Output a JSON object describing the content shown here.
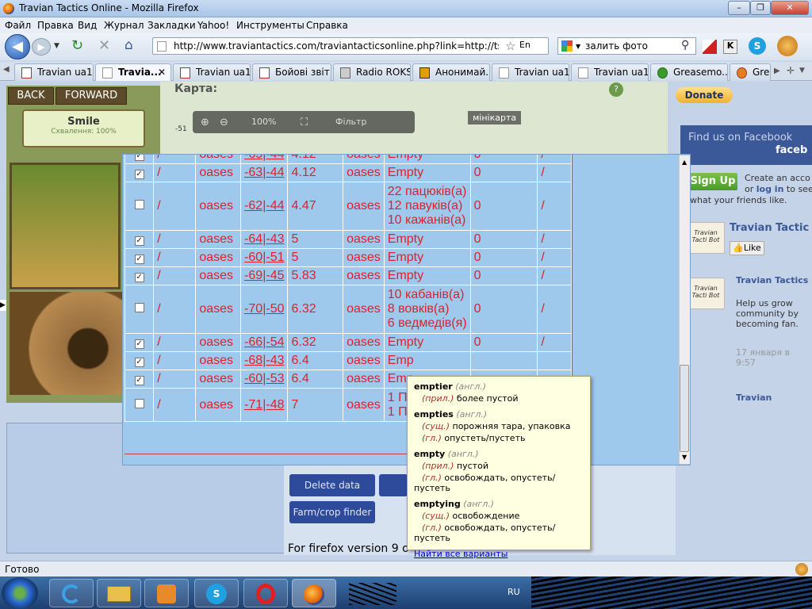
{
  "window": {
    "title": "Travian Tactics Online - Mozilla Firefox"
  },
  "menu": [
    "Файл",
    "Правка",
    "Вид",
    "Журнал",
    "Закладки",
    "Yahoo!",
    "Инструменты",
    "Справка"
  ],
  "nav": {
    "url": "http://www.traviantactics.com/traviantacticsonline.php?link=http://ts1.traviar",
    "search_value": "залить фото",
    "lang_badge": "En"
  },
  "tabs": [
    {
      "label": "Travian ua1"
    },
    {
      "label": "Travia..."
    },
    {
      "label": "Travian ua1"
    },
    {
      "label": "Бойові звіт..."
    },
    {
      "label": "Radio ROKS"
    },
    {
      "label": "Анонимай..."
    },
    {
      "label": "Travian ua1"
    },
    {
      "label": "Travian ua1"
    },
    {
      "label": "Greasemo..."
    },
    {
      "label": "Grea"
    }
  ],
  "page": {
    "back": "BACK",
    "forward": "FORWARD",
    "smile_title": "Smile",
    "smile_sub": "Схвалення: 100%",
    "map_title": "Карта:",
    "zoom": "100%",
    "filter": "Фільтр",
    "minimap": "мінікарта",
    "delete_data": "Delete data",
    "farm_finder": "Farm/crop finder",
    "firefox_note": "For firefox version 9 o",
    "side_num": "-51"
  },
  "sidebar": {
    "donate": "Donate",
    "facebook": "Find us on Facebook",
    "facebook_tail": "faceb",
    "signup": "Sign Up",
    "create": "Create an acco",
    "or": "or",
    "login": "log in",
    "to_see": "to see",
    "friends": "what your friends like.",
    "page_name": "Travian Tactic",
    "like": "Like",
    "thumb1": "Travian Tacti Bot",
    "post_title": "Travian Tactics",
    "post_text": "Help us grow community by becoming fan.",
    "post_date": "17 января в 9:57",
    "thumb2": "Travian Tacti Bot",
    "post2_title": "Travian"
  },
  "table": {
    "rows": [
      {
        "checked": true,
        "slash": "/",
        "type": "oases",
        "coord": "-65|-44",
        "dist": "4.12",
        "kind": "oases",
        "content": [
          "Empty"
        ],
        "n": "0",
        "end": "/"
      },
      {
        "checked": true,
        "slash": "/",
        "type": "oases",
        "coord": "-63|-44",
        "dist": "4.12",
        "kind": "oases",
        "content": [
          "Empty"
        ],
        "n": "0",
        "end": "/"
      },
      {
        "checked": false,
        "slash": "/",
        "type": "oases",
        "coord": "-62|-44",
        "dist": "4.47",
        "kind": "oases",
        "content": [
          "22 пацюків(а)",
          "12 павуків(а)",
          "10 кажанів(а)"
        ],
        "n": "0",
        "end": "/"
      },
      {
        "checked": true,
        "slash": "/",
        "type": "oases",
        "coord": "-64|-43",
        "dist": "5",
        "kind": "oases",
        "content": [
          "Empty"
        ],
        "n": "0",
        "end": "/"
      },
      {
        "checked": true,
        "slash": "/",
        "type": "oases",
        "coord": "-60|-51",
        "dist": "5",
        "kind": "oases",
        "content": [
          "Empty"
        ],
        "n": "0",
        "end": "/"
      },
      {
        "checked": true,
        "slash": "/",
        "type": "oases",
        "coord": "-69|-45",
        "dist": "5.83",
        "kind": "oases",
        "content": [
          "Empty"
        ],
        "n": "0",
        "end": "/"
      },
      {
        "checked": false,
        "slash": "/",
        "type": "oases",
        "coord": "-70|-50",
        "dist": "6.32",
        "kind": "oases",
        "content": [
          "10 кабанів(а)",
          "8 вовків(а)",
          "6 ведмедів(я)"
        ],
        "n": "0",
        "end": "/"
      },
      {
        "checked": true,
        "slash": "/",
        "type": "oases",
        "coord": "-66|-54",
        "dist": "6.32",
        "kind": "oases",
        "content": [
          "Empty"
        ],
        "n": "0",
        "end": "/"
      },
      {
        "checked": true,
        "slash": "/",
        "type": "oases",
        "coord": "-68|-43",
        "dist": "6.4",
        "kind": "oases",
        "content": [
          "Emp"
        ],
        "n": "",
        "end": ""
      },
      {
        "checked": true,
        "slash": "/",
        "type": "oases",
        "coord": "-60|-53",
        "dist": "6.4",
        "kind": "oases",
        "content": [
          "Emp"
        ],
        "n": "",
        "end": ""
      },
      {
        "checked": false,
        "slash": "/",
        "type": "oases",
        "coord": "-71|-48",
        "dist": "7",
        "kind": "oases",
        "content": [
          "1 Па",
          "1 Па"
        ],
        "n": "",
        "end": ""
      }
    ]
  },
  "tooltip": {
    "entries": [
      {
        "word": "emptier",
        "lang": "(англ.)",
        "defs": [
          {
            "pos": "(прил.)",
            "text": "более пустой"
          }
        ]
      },
      {
        "word": "empties",
        "lang": "(англ.)",
        "defs": [
          {
            "pos": "(сущ.)",
            "text": "порожняя тара, упаковка"
          },
          {
            "pos": "(гл.)",
            "text": "опустеть/пустеть"
          }
        ]
      },
      {
        "word": "empty",
        "lang": "(англ.)",
        "defs": [
          {
            "pos": "(прил.)",
            "text": "пустой"
          },
          {
            "pos": "(гл.)",
            "text": "освобождать, опустеть/пустеть"
          }
        ]
      },
      {
        "word": "emptying",
        "lang": "(англ.)",
        "defs": [
          {
            "pos": "(сущ.)",
            "text": "освобождение"
          },
          {
            "pos": "(гл.)",
            "text": "освобождать, опустеть/пустеть"
          }
        ]
      }
    ],
    "link": "Найти все варианты"
  },
  "status": {
    "text": "Готово"
  },
  "taskbar": {
    "lang": "RU"
  }
}
